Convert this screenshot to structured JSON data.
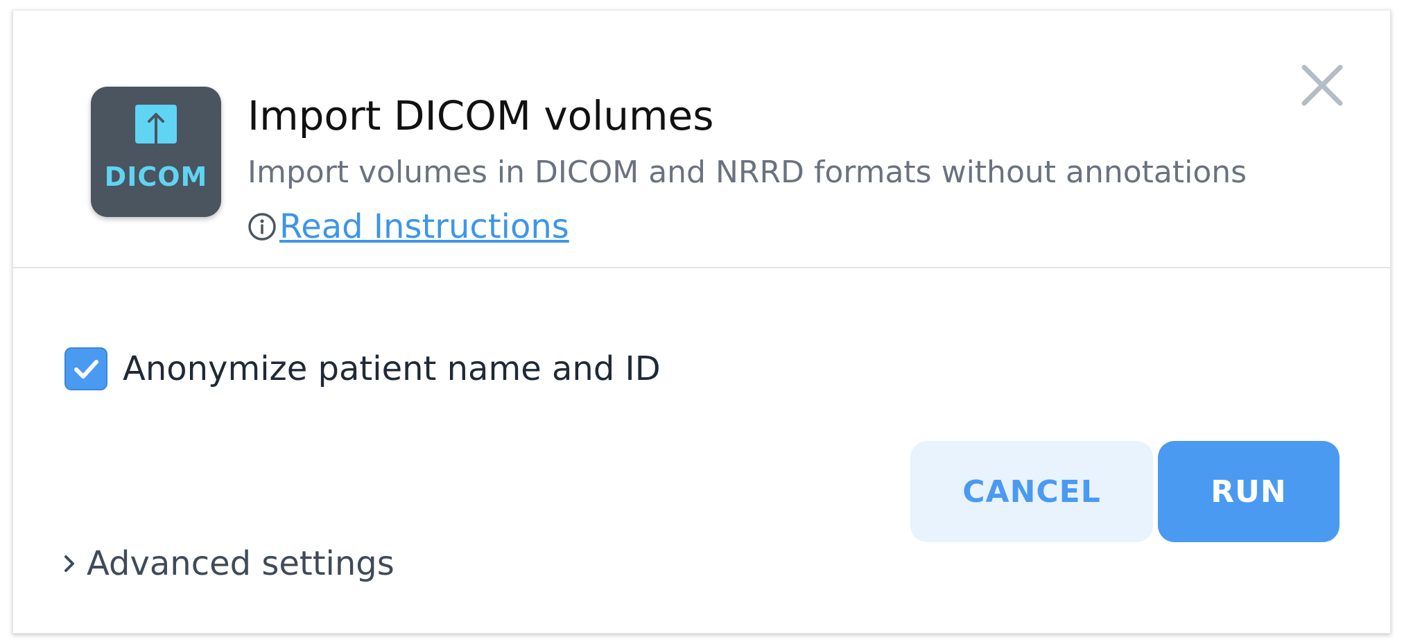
{
  "dialog": {
    "title": "Import DICOM volumes",
    "subtitle": "Import volumes in DICOM and NRRD formats without annotations",
    "instructions_link": "Read Instructions",
    "app_icon_label": "DICOM",
    "close_icon": "close-icon",
    "info_icon": "info-icon",
    "upload_icon": "upload-arrow-icon"
  },
  "options": {
    "anonymize": {
      "label": "Anonymize patient name and ID",
      "checked": true
    }
  },
  "actions": {
    "cancel_label": "CANCEL",
    "run_label": "RUN"
  },
  "advanced": {
    "label": "Advanced settings",
    "icon": "chevron-right-icon"
  },
  "colors": {
    "accent": "#4a9af2",
    "app_icon_bg": "#4a5560",
    "app_icon_fg": "#5fd4f3",
    "cancel_bg": "#e8f3fd",
    "link": "#3d95ea"
  }
}
